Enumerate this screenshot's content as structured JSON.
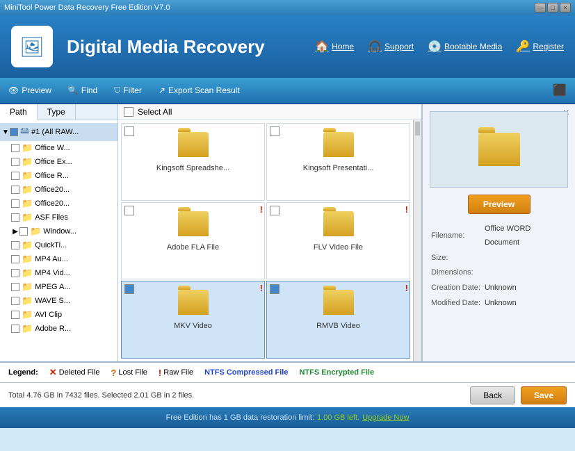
{
  "titlebar": {
    "title": "MiniTool Power Data Recovery Free Edition V7.0",
    "buttons": [
      "—",
      "□",
      "×"
    ]
  },
  "header": {
    "logo_symbol": "🖼",
    "title": "Digital Media Recovery",
    "nav": [
      {
        "icon": "🏠",
        "label": "Home"
      },
      {
        "icon": "🎧",
        "label": "Support"
      },
      {
        "icon": "💿",
        "label": "Bootable Media"
      },
      {
        "icon": "🔑",
        "label": "Register"
      }
    ]
  },
  "toolbar": {
    "preview_label": "Preview",
    "find_label": "Find",
    "filter_label": "Filter",
    "export_label": "Export Scan Result"
  },
  "tabs": {
    "path_label": "Path",
    "type_label": "Type"
  },
  "tree": {
    "items": [
      {
        "label": "#1 (All RAW...",
        "type": "root",
        "expanded": true,
        "checked": true
      },
      {
        "label": "Office W...",
        "type": "folder",
        "indent": 1
      },
      {
        "label": "Office Ex...",
        "type": "folder",
        "indent": 1
      },
      {
        "label": "Office R...",
        "type": "folder",
        "indent": 1
      },
      {
        "label": "Office20...",
        "type": "folder",
        "indent": 1
      },
      {
        "label": "Office20...",
        "type": "folder",
        "indent": 1
      },
      {
        "label": "ASF Files",
        "type": "folder",
        "indent": 1
      },
      {
        "label": "Window...",
        "type": "folder",
        "indent": 1,
        "has_children": true
      },
      {
        "label": "QuickTi...",
        "type": "folder",
        "indent": 1
      },
      {
        "label": "MP4 Au...",
        "type": "folder",
        "indent": 1
      },
      {
        "label": "MP4 Vid...",
        "type": "folder",
        "indent": 1
      },
      {
        "label": "MPEG A...",
        "type": "folder",
        "indent": 1
      },
      {
        "label": "WAVE S...",
        "type": "folder",
        "indent": 1
      },
      {
        "label": "AVI Clip",
        "type": "folder",
        "indent": 1
      },
      {
        "label": "Adobe R...",
        "type": "folder",
        "indent": 1
      }
    ]
  },
  "file_panel": {
    "select_all": "Select All",
    "files": [
      {
        "name": "Kingsoft Spreadshe...",
        "type": "folder",
        "raw": true,
        "checked": false
      },
      {
        "name": "Kingsoft Presentati...",
        "type": "folder",
        "raw": true,
        "checked": false
      },
      {
        "name": "Adobe FLA File",
        "type": "folder",
        "raw": true,
        "checked": false
      },
      {
        "name": "FLV Video File",
        "type": "folder",
        "raw": true,
        "checked": false
      },
      {
        "name": "MKV Video",
        "type": "folder",
        "raw": true,
        "checked": true
      },
      {
        "name": "RMVB Video",
        "type": "folder",
        "raw": true,
        "checked": true
      }
    ]
  },
  "preview": {
    "button_label": "Preview",
    "filename_label": "Filename:",
    "filename_value": "Office WORD Document",
    "size_label": "Size:",
    "size_value": "",
    "dimensions_label": "Dimensions:",
    "dimensions_value": "",
    "creation_label": "Creation Date:",
    "creation_value": "Unknown",
    "modified_label": "Modified Date:",
    "modified_value": "Unknown"
  },
  "legend": {
    "deleted_label": "Deleted File",
    "lost_label": "Lost File",
    "raw_label": "Raw File",
    "ntfs_c_label": "NTFS Compressed File",
    "ntfs_e_label": "NTFS Encrypted File"
  },
  "status": {
    "total_text": "Total 4.76 GB in 7432 files.  Selected 2.01 GB in 2 files.",
    "back_label": "Back",
    "save_label": "Save"
  },
  "footer": {
    "text": "Free Edition has 1 GB data restoration limit:",
    "gb_left": "1.00 GB left.",
    "upgrade_label": "Upgrade Now"
  }
}
